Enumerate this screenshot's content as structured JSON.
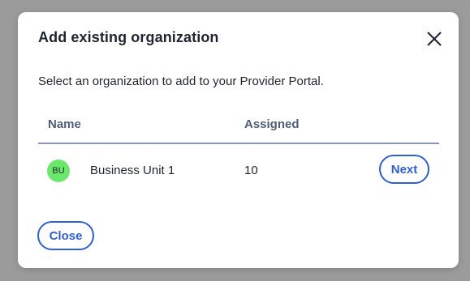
{
  "dialog": {
    "title": "Add existing organization",
    "close_icon": "close-icon",
    "subtitle": "Select an organization to add to your Provider Portal.",
    "close_button_label": "Close"
  },
  "table": {
    "columns": [
      "Name",
      "Assigned"
    ],
    "rows": [
      {
        "avatar_initials": "BU",
        "avatar_color": "#6be86b",
        "name": "Business Unit 1",
        "assigned": "10",
        "action_label": "Next"
      }
    ]
  },
  "colors": {
    "accent": "#2f5fd1",
    "backdrop": "#9b9b9b",
    "header_text": "#4f5d78"
  }
}
